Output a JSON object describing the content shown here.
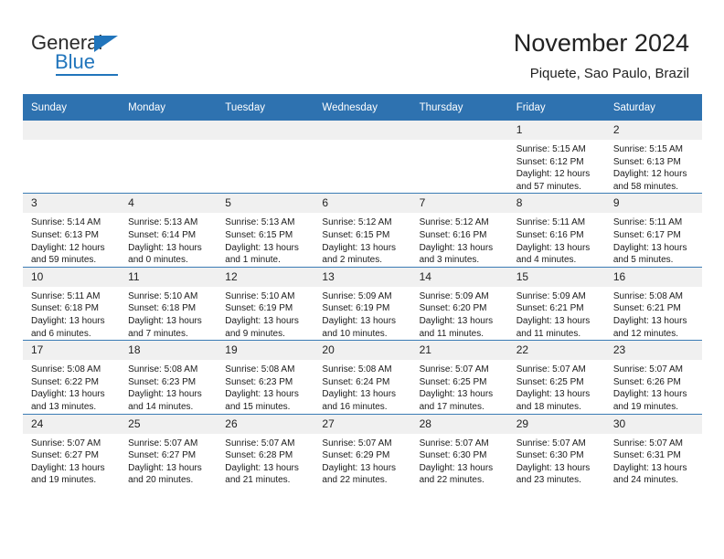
{
  "brand": {
    "line1": "General",
    "line2": "Blue",
    "triangle_icon": "brand-triangle-icon",
    "accent_color": "#2175bc"
  },
  "header": {
    "title": "November 2024",
    "subtitle": "Piquete, Sao Paulo, Brazil",
    "header_bar_color": "#2e72b0",
    "daynum_bg_color": "#f0f0f0"
  },
  "weekdays": [
    "Sunday",
    "Monday",
    "Tuesday",
    "Wednesday",
    "Thursday",
    "Friday",
    "Saturday"
  ],
  "weeks": [
    [
      {
        "day": "",
        "sunrise": "",
        "sunset": "",
        "daylight1": "",
        "daylight2": ""
      },
      {
        "day": "",
        "sunrise": "",
        "sunset": "",
        "daylight1": "",
        "daylight2": ""
      },
      {
        "day": "",
        "sunrise": "",
        "sunset": "",
        "daylight1": "",
        "daylight2": ""
      },
      {
        "day": "",
        "sunrise": "",
        "sunset": "",
        "daylight1": "",
        "daylight2": ""
      },
      {
        "day": "",
        "sunrise": "",
        "sunset": "",
        "daylight1": "",
        "daylight2": ""
      },
      {
        "day": "1",
        "sunrise": "Sunrise: 5:15 AM",
        "sunset": "Sunset: 6:12 PM",
        "daylight1": "Daylight: 12 hours",
        "daylight2": "and 57 minutes."
      },
      {
        "day": "2",
        "sunrise": "Sunrise: 5:15 AM",
        "sunset": "Sunset: 6:13 PM",
        "daylight1": "Daylight: 12 hours",
        "daylight2": "and 58 minutes."
      }
    ],
    [
      {
        "day": "3",
        "sunrise": "Sunrise: 5:14 AM",
        "sunset": "Sunset: 6:13 PM",
        "daylight1": "Daylight: 12 hours",
        "daylight2": "and 59 minutes."
      },
      {
        "day": "4",
        "sunrise": "Sunrise: 5:13 AM",
        "sunset": "Sunset: 6:14 PM",
        "daylight1": "Daylight: 13 hours",
        "daylight2": "and 0 minutes."
      },
      {
        "day": "5",
        "sunrise": "Sunrise: 5:13 AM",
        "sunset": "Sunset: 6:15 PM",
        "daylight1": "Daylight: 13 hours",
        "daylight2": "and 1 minute."
      },
      {
        "day": "6",
        "sunrise": "Sunrise: 5:12 AM",
        "sunset": "Sunset: 6:15 PM",
        "daylight1": "Daylight: 13 hours",
        "daylight2": "and 2 minutes."
      },
      {
        "day": "7",
        "sunrise": "Sunrise: 5:12 AM",
        "sunset": "Sunset: 6:16 PM",
        "daylight1": "Daylight: 13 hours",
        "daylight2": "and 3 minutes."
      },
      {
        "day": "8",
        "sunrise": "Sunrise: 5:11 AM",
        "sunset": "Sunset: 6:16 PM",
        "daylight1": "Daylight: 13 hours",
        "daylight2": "and 4 minutes."
      },
      {
        "day": "9",
        "sunrise": "Sunrise: 5:11 AM",
        "sunset": "Sunset: 6:17 PM",
        "daylight1": "Daylight: 13 hours",
        "daylight2": "and 5 minutes."
      }
    ],
    [
      {
        "day": "10",
        "sunrise": "Sunrise: 5:11 AM",
        "sunset": "Sunset: 6:18 PM",
        "daylight1": "Daylight: 13 hours",
        "daylight2": "and 6 minutes."
      },
      {
        "day": "11",
        "sunrise": "Sunrise: 5:10 AM",
        "sunset": "Sunset: 6:18 PM",
        "daylight1": "Daylight: 13 hours",
        "daylight2": "and 7 minutes."
      },
      {
        "day": "12",
        "sunrise": "Sunrise: 5:10 AM",
        "sunset": "Sunset: 6:19 PM",
        "daylight1": "Daylight: 13 hours",
        "daylight2": "and 9 minutes."
      },
      {
        "day": "13",
        "sunrise": "Sunrise: 5:09 AM",
        "sunset": "Sunset: 6:19 PM",
        "daylight1": "Daylight: 13 hours",
        "daylight2": "and 10 minutes."
      },
      {
        "day": "14",
        "sunrise": "Sunrise: 5:09 AM",
        "sunset": "Sunset: 6:20 PM",
        "daylight1": "Daylight: 13 hours",
        "daylight2": "and 11 minutes."
      },
      {
        "day": "15",
        "sunrise": "Sunrise: 5:09 AM",
        "sunset": "Sunset: 6:21 PM",
        "daylight1": "Daylight: 13 hours",
        "daylight2": "and 11 minutes."
      },
      {
        "day": "16",
        "sunrise": "Sunrise: 5:08 AM",
        "sunset": "Sunset: 6:21 PM",
        "daylight1": "Daylight: 13 hours",
        "daylight2": "and 12 minutes."
      }
    ],
    [
      {
        "day": "17",
        "sunrise": "Sunrise: 5:08 AM",
        "sunset": "Sunset: 6:22 PM",
        "daylight1": "Daylight: 13 hours",
        "daylight2": "and 13 minutes."
      },
      {
        "day": "18",
        "sunrise": "Sunrise: 5:08 AM",
        "sunset": "Sunset: 6:23 PM",
        "daylight1": "Daylight: 13 hours",
        "daylight2": "and 14 minutes."
      },
      {
        "day": "19",
        "sunrise": "Sunrise: 5:08 AM",
        "sunset": "Sunset: 6:23 PM",
        "daylight1": "Daylight: 13 hours",
        "daylight2": "and 15 minutes."
      },
      {
        "day": "20",
        "sunrise": "Sunrise: 5:08 AM",
        "sunset": "Sunset: 6:24 PM",
        "daylight1": "Daylight: 13 hours",
        "daylight2": "and 16 minutes."
      },
      {
        "day": "21",
        "sunrise": "Sunrise: 5:07 AM",
        "sunset": "Sunset: 6:25 PM",
        "daylight1": "Daylight: 13 hours",
        "daylight2": "and 17 minutes."
      },
      {
        "day": "22",
        "sunrise": "Sunrise: 5:07 AM",
        "sunset": "Sunset: 6:25 PM",
        "daylight1": "Daylight: 13 hours",
        "daylight2": "and 18 minutes."
      },
      {
        "day": "23",
        "sunrise": "Sunrise: 5:07 AM",
        "sunset": "Sunset: 6:26 PM",
        "daylight1": "Daylight: 13 hours",
        "daylight2": "and 19 minutes."
      }
    ],
    [
      {
        "day": "24",
        "sunrise": "Sunrise: 5:07 AM",
        "sunset": "Sunset: 6:27 PM",
        "daylight1": "Daylight: 13 hours",
        "daylight2": "and 19 minutes."
      },
      {
        "day": "25",
        "sunrise": "Sunrise: 5:07 AM",
        "sunset": "Sunset: 6:27 PM",
        "daylight1": "Daylight: 13 hours",
        "daylight2": "and 20 minutes."
      },
      {
        "day": "26",
        "sunrise": "Sunrise: 5:07 AM",
        "sunset": "Sunset: 6:28 PM",
        "daylight1": "Daylight: 13 hours",
        "daylight2": "and 21 minutes."
      },
      {
        "day": "27",
        "sunrise": "Sunrise: 5:07 AM",
        "sunset": "Sunset: 6:29 PM",
        "daylight1": "Daylight: 13 hours",
        "daylight2": "and 22 minutes."
      },
      {
        "day": "28",
        "sunrise": "Sunrise: 5:07 AM",
        "sunset": "Sunset: 6:30 PM",
        "daylight1": "Daylight: 13 hours",
        "daylight2": "and 22 minutes."
      },
      {
        "day": "29",
        "sunrise": "Sunrise: 5:07 AM",
        "sunset": "Sunset: 6:30 PM",
        "daylight1": "Daylight: 13 hours",
        "daylight2": "and 23 minutes."
      },
      {
        "day": "30",
        "sunrise": "Sunrise: 5:07 AM",
        "sunset": "Sunset: 6:31 PM",
        "daylight1": "Daylight: 13 hours",
        "daylight2": "and 24 minutes."
      }
    ]
  ]
}
